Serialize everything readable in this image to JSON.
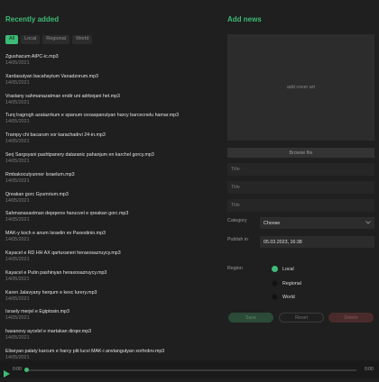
{
  "recent": {
    "title": "Recently added",
    "filters": [
      "All",
      "Local",
      "Regional",
      "World"
    ],
    "items": [
      {
        "title": "Zgushacum AIPC-ic.mp3",
        "date": "14/05/2021"
      },
      {
        "title": "Xardasutyan bacahaytum Vanadzorum.mp3",
        "date": "14/05/2021"
      },
      {
        "title": "Vrastany sahmanazatman endir uni adrbejani het.mp3",
        "date": "14/05/2021"
      },
      {
        "title": "Turq lragrogh azatazrkum e spanum cexaspanutyan harcy barcecnelu hamar.mp3",
        "date": "14/05/2021"
      },
      {
        "title": "Trampy chi bacarum vor karachadrvi 24-in.mp3",
        "date": "14/05/2021"
      },
      {
        "title": "Serj Sargsyani pashtpanery dataranic pahanjum en karchel gorcy.mp3",
        "date": "14/05/2021"
      },
      {
        "title": "Rmbakocutyunner Israelum.mp3",
        "date": "14/05/2021"
      },
      {
        "title": "Qreakan gorc Gyumrium.mp3",
        "date": "14/05/2021"
      },
      {
        "title": "Sahmanaxaxtman depqerov harucvel e qreakan gorc.mp3",
        "date": "14/05/2021"
      },
      {
        "title": "MAK-y koch e anum Israelin ev Paxestinin.mp3",
        "date": "14/05/2021"
      },
      {
        "title": "Kayacel e RD HH AX qartuxaneri heraxosazruycy.mp3",
        "date": "14/05/2021"
      },
      {
        "title": "Kayacel e Putin pashinyan heraxosazruycy.mp3",
        "date": "14/05/2021"
      },
      {
        "title": "Karen Jalavyany herqum e kexc lurery.mp3",
        "date": "14/05/2021"
      },
      {
        "title": "Israely merjel e Egiptosin.mp3",
        "date": "14/05/2021"
      },
      {
        "title": "hasanovy aycelel e martakan dirqer.mp3",
        "date": "14/05/2021"
      },
      {
        "title": "Eliseyan palaty karcum e harcy piti lucvi MAK-i anvtangutyan xorhrdov.mp3",
        "date": "14/05/2021"
      }
    ]
  },
  "add_news": {
    "title": "Add news",
    "cover_placeholder": "add cover art",
    "browse_label": "Browse file",
    "title_fields": [
      "Title",
      "Title",
      "Title"
    ],
    "category_label": "Category",
    "category_value": "Choose",
    "publish_label": "Publish in",
    "publish_value": "05.03.2023, 16:38",
    "region_label": "Region",
    "regions": [
      "Local",
      "Regional",
      "World"
    ],
    "selected_region": "Local",
    "save_label": "Save",
    "reset_label": "Reset",
    "delete_label": "Delete"
  },
  "player": {
    "current_time": "0:00",
    "total_time": "0:00",
    "progress": 0
  },
  "colors": {
    "accent": "#3dbb76",
    "background": "#1f1f1f"
  }
}
